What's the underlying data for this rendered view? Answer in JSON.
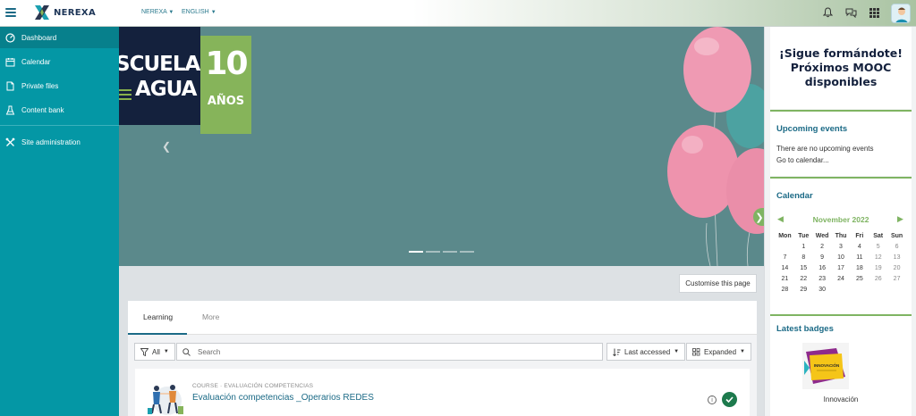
{
  "header": {
    "logo_text": "NEREXA",
    "menu_site": "NEREXA",
    "menu_language": "ENGLISH",
    "icons": [
      "menu-icon",
      "bell-icon",
      "chat-icon",
      "apps-grid-icon",
      "user-avatar"
    ]
  },
  "sidebar": {
    "items": [
      {
        "label": "Dashboard",
        "icon": "dashboard-icon",
        "active": true
      },
      {
        "label": "Calendar",
        "icon": "calendar-icon"
      },
      {
        "label": "Private files",
        "icon": "file-icon"
      },
      {
        "label": "Content bank",
        "icon": "content-bank-icon"
      },
      {
        "label": "Site administration",
        "icon": "wrench-icon"
      }
    ]
  },
  "hero": {
    "line1": "SCUELA",
    "line2": "AGUA",
    "anniversary_number": "10",
    "anniversary_word": "AÑOS",
    "slide_count": 4,
    "active_slide": 1
  },
  "page": {
    "customise_label": "Customise this page"
  },
  "main": {
    "tabs": [
      {
        "label": "Learning",
        "active": true
      },
      {
        "label": "More",
        "active": false
      }
    ],
    "filter_label": "All",
    "search_placeholder": "Search",
    "sort_label": "Last accessed",
    "view_label": "Expanded",
    "course": {
      "meta": "COURSE · EVALUACIÓN COMPETENCIAS",
      "title": "Evaluación competencias _Operarios REDES",
      "completed": true
    }
  },
  "right_panel": {
    "mooc_line1": "¡Sigue formándote!",
    "mooc_line2": "Próximos MOOC",
    "mooc_line3": "disponibles",
    "upcoming_title": "Upcoming events",
    "upcoming_empty": "There are no upcoming events",
    "upcoming_link": "Go to calendar...",
    "calendar_title": "Calendar",
    "calendar_month": "November 2022",
    "calendar_days": [
      "Mon",
      "Tue",
      "Wed",
      "Thu",
      "Fri",
      "Sat",
      "Sun"
    ],
    "calendar_cells": [
      "",
      "1",
      "2",
      "3",
      "4",
      "5",
      "6",
      "7",
      "8",
      "9",
      "10",
      "11",
      "12",
      "13",
      "14",
      "15",
      "16",
      "17",
      "18",
      "19",
      "20",
      "21",
      "22",
      "23",
      "24",
      "25",
      "26",
      "27",
      "28",
      "29",
      "30",
      "",
      "",
      "",
      ""
    ],
    "badges_title": "Latest badges",
    "badge_label": "Innovación",
    "badge_image_text": "INNOVACIÓN"
  },
  "colors": {
    "sidebar": "#0497a5",
    "sidebar_active": "#07808c",
    "accent": "#1b6a86",
    "green": "#7fb462",
    "navy": "#14213d"
  }
}
